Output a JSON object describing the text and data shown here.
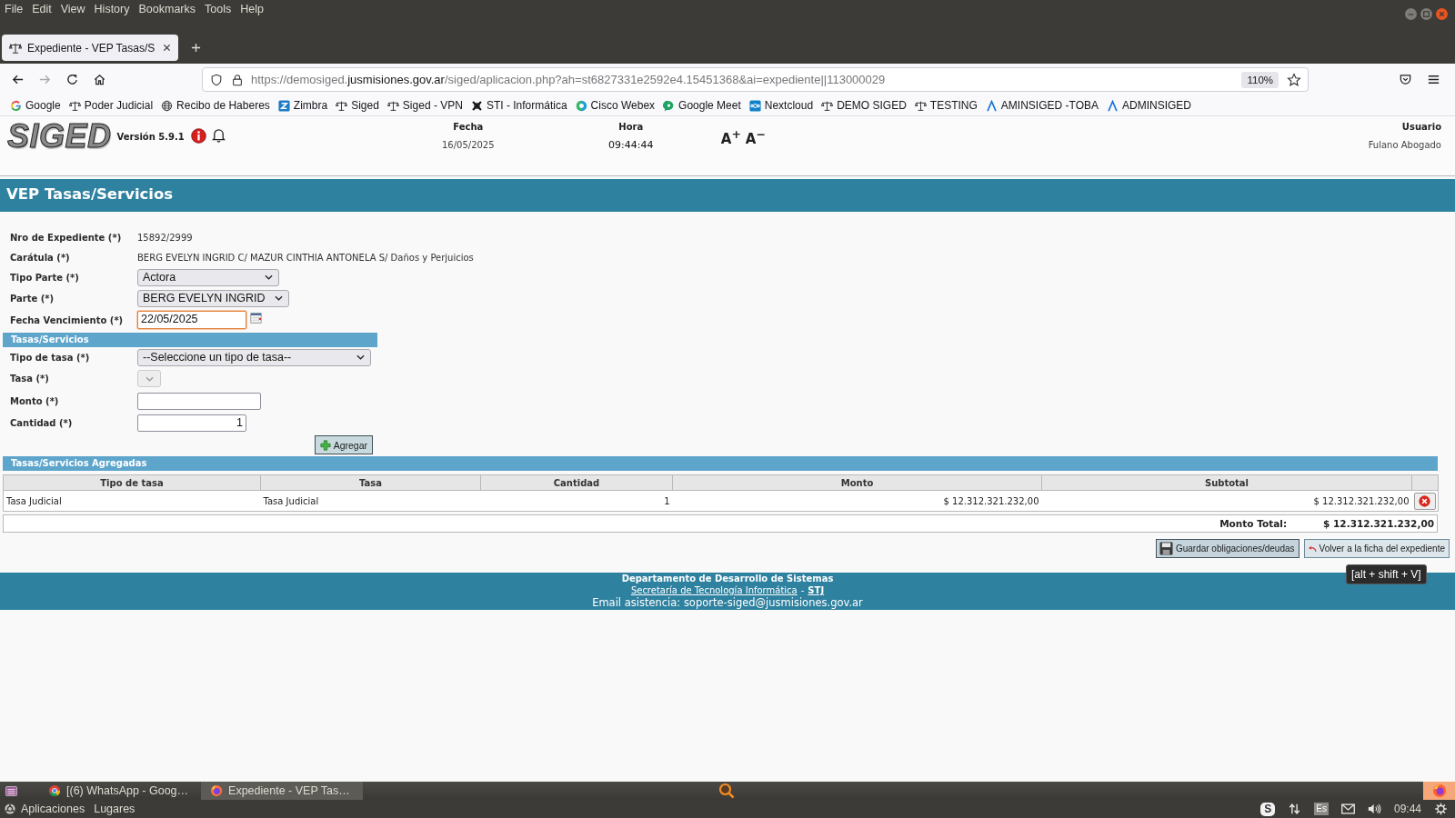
{
  "browser": {
    "menu": [
      "File",
      "Edit",
      "View",
      "History",
      "Bookmarks",
      "Tools",
      "Help"
    ],
    "tab": {
      "title": "Expediente - VEP Tasas/S",
      "selected": true
    },
    "address": {
      "scheme": "https://demosiged.",
      "domain": "jusmisiones.gov.ar",
      "path": "/siged/aplicacion.php?ah=st6827331e2592e4.15451368&ai=expediente||113000029"
    },
    "zoom": "110%",
    "bookmarks": [
      {
        "label": "Google",
        "kind": "google"
      },
      {
        "label": "Poder Judicial",
        "kind": "scales"
      },
      {
        "label": "Recibo de Haberes",
        "kind": "globe"
      },
      {
        "label": "Zimbra",
        "kind": "zimbra"
      },
      {
        "label": "Siged",
        "kind": "scales"
      },
      {
        "label": "Siged - VPN",
        "kind": "scales"
      },
      {
        "label": "STI - Informática",
        "kind": "sti"
      },
      {
        "label": "Cisco Webex",
        "kind": "webex"
      },
      {
        "label": "Google Meet",
        "kind": "meet"
      },
      {
        "label": "Nextcloud",
        "kind": "nextcloud"
      },
      {
        "label": "DEMO SIGED",
        "kind": "scales"
      },
      {
        "label": "TESTING",
        "kind": "scales"
      },
      {
        "label": "AMINSIGED -TOBA",
        "kind": "peak"
      },
      {
        "label": "ADMINSIGED",
        "kind": "peak"
      }
    ]
  },
  "header": {
    "logo": "SIGED",
    "version": "Versión 5.9.1",
    "date_label": "Fecha",
    "date": "16/05/2025",
    "time_label": "Hora",
    "time": "09:44:44",
    "text_larger": "A$^{+}$",
    "text_smaller": "A$^{−}$",
    "user_label": "Usuario",
    "user": "Fulano Abogado"
  },
  "page_title": "VEP Tasas/Servicios",
  "expediente": {
    "fields": [
      {
        "label": "Nro de Expediente (*)",
        "kind": "text",
        "value": "15892/2999"
      },
      {
        "label": "Carátula (*)",
        "kind": "text",
        "value": "BERG EVELYN INGRID C/ MAZUR CINTHIA ANTONELA S/ Daños y Perjuicios"
      },
      {
        "label": "Tipo Parte (*)",
        "kind": "select",
        "value": "Actora",
        "disabled": false,
        "focused": false
      },
      {
        "label": "Parte (*)",
        "kind": "select",
        "value": "BERG EVELYN INGRID",
        "disabled": false,
        "focused": false
      },
      {
        "label": "Fecha Vencimiento (*)",
        "kind": "date",
        "value": "22/05/2025",
        "disabled": false,
        "focused": true
      }
    ]
  },
  "tasas": {
    "title": "Tasas/Servicios",
    "fields": [
      {
        "label": "Tipo de tasa (*)",
        "kind": "select",
        "value": "--Seleccione un tipo de tasa--",
        "disabled": false,
        "focused": false
      },
      {
        "label": "Tasa (*)",
        "kind": "select",
        "disabled": true,
        "focused": false
      },
      {
        "label": "Monto (*)",
        "kind": "input",
        "disabled": false,
        "focused": false
      },
      {
        "label": "Cantidad (*)",
        "kind": "input",
        "value": "1",
        "disabled": false,
        "focused": false
      }
    ],
    "add_button": "Agregar"
  },
  "added": {
    "title": "Tasas/Servicios Agregadas",
    "columns": [
      "Tipo de tasa",
      "Tasa",
      "Cantidad",
      "Monto",
      "Subtotal"
    ],
    "rows": [
      {
        "cells": [
          "Tasa Judicial",
          "Tasa Judicial",
          "1",
          "$ 12.312.321.232,00",
          "$ 12.312.321.232,00"
        ]
      }
    ],
    "total_label": "Monto Total:",
    "total": "$ 12.312.321.232,00"
  },
  "actions": [
    {
      "label": "Guardar obligaciones/deudas",
      "kind": "save"
    },
    {
      "label": "Volver a la ficha del expediente",
      "kind": "back"
    }
  ],
  "tooltip": "[alt + shift + V]",
  "footer": {
    "department": "Departamento de Desarrollo de Sistemas",
    "secretaria": "Secretaría de Tecnología Informática",
    "separator": "-",
    "stj": "STJ",
    "email": "Email asistencia: soporte-siged@jusmisiones.gov.ar"
  },
  "taskbar": {
    "windows": [
      {
        "label": "[(6) WhatsApp - Goog…",
        "kind": "chrome",
        "selected": false
      },
      {
        "label": "Expediente - VEP Tas…",
        "kind": "firefox",
        "selected": true
      }
    ],
    "places": [
      "Aplicaciones",
      "Lugares"
    ],
    "tray": [
      {
        "kind": "app",
        "label": "S"
      },
      {
        "kind": "arrows"
      },
      {
        "kind": "keyboard",
        "label": "Es"
      },
      {
        "kind": "mail"
      },
      {
        "kind": "volume"
      }
    ],
    "clock": "09:44"
  }
}
